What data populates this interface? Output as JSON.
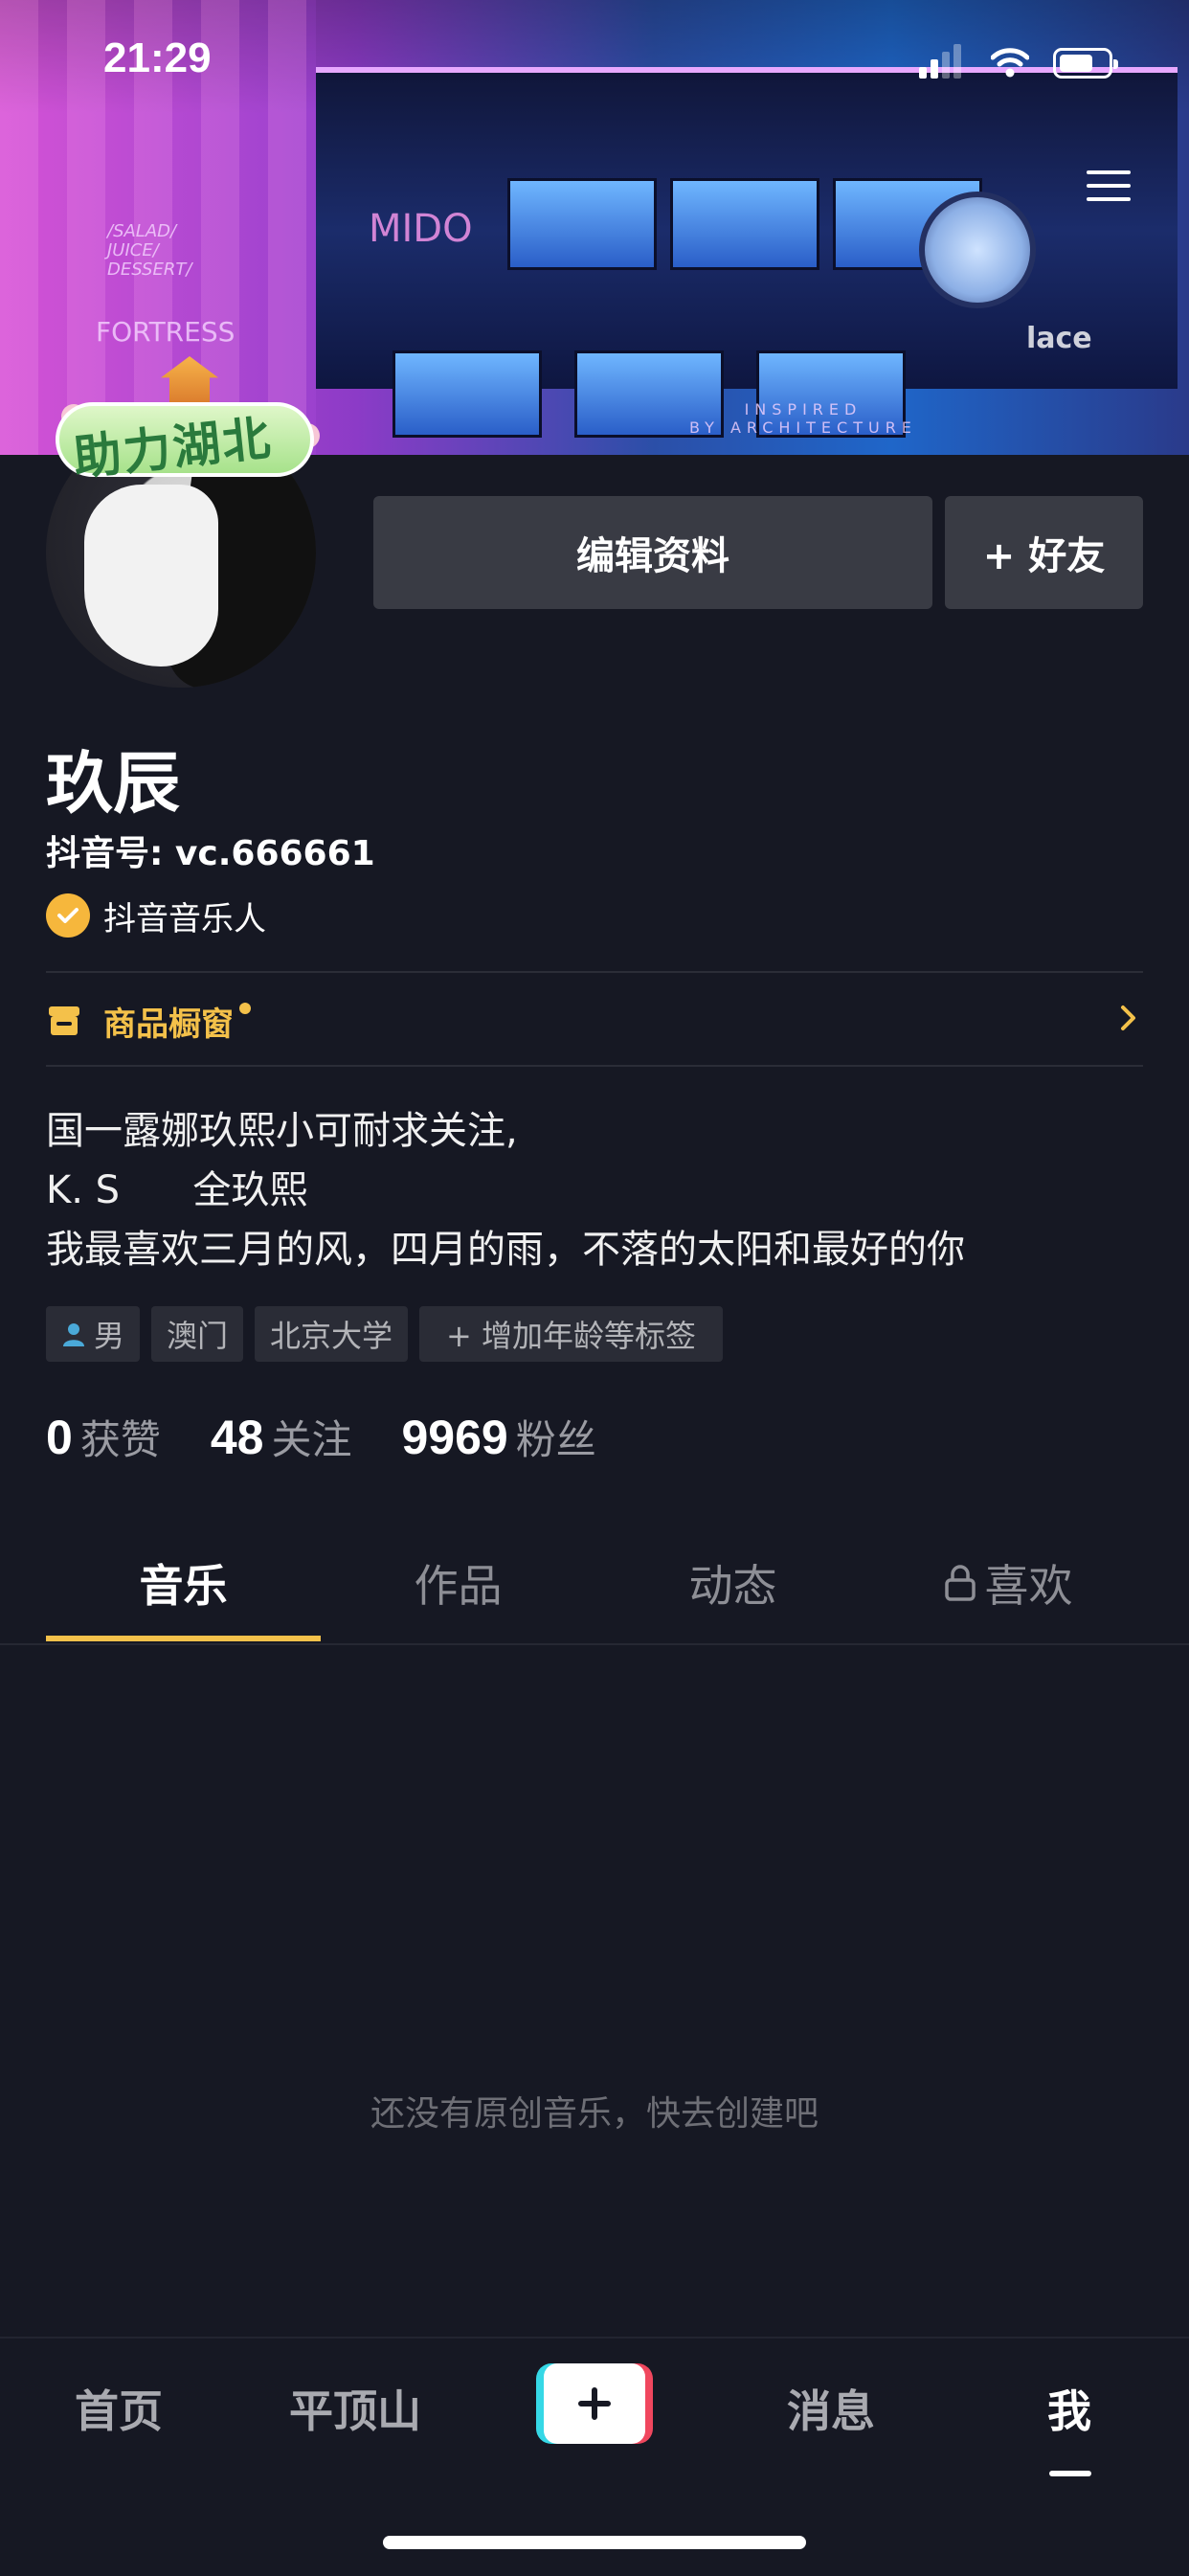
{
  "status_bar": {
    "time": "21:29"
  },
  "cover": {
    "texts": [
      "/SALAD/",
      "JUICE/",
      "DESSERT/",
      "FORTRESS",
      "MIDO",
      "lace",
      "INSPIRED",
      "BY ARCHITECTURE"
    ]
  },
  "avatar_badge": {
    "text": "助力湖北"
  },
  "actions": {
    "edit_profile": "编辑资料",
    "add_friend": "+ 好友"
  },
  "profile": {
    "name": "玖辰",
    "douyin_id": "抖音号: vc.666661",
    "verified_label": "抖音音乐人"
  },
  "shop": {
    "label": "商品橱窗"
  },
  "bio": {
    "line1": "国一露娜玖熙小可耐求关注,",
    "line2": "K. S      全玖熙",
    "line3": "我最喜欢三月的风，四月的雨，不落的太阳和最好的你"
  },
  "tags": {
    "gender": "男",
    "location": "澳门",
    "school": "北京大学",
    "add": "+ 增加年龄等标签"
  },
  "stats": {
    "likes_num": "0",
    "likes_label": "获赞",
    "following_num": "48",
    "following_label": "关注",
    "followers_num": "9969",
    "followers_label": "粉丝"
  },
  "tabs": {
    "music": "音乐",
    "works": "作品",
    "dynamics": "动态",
    "likes": "喜欢"
  },
  "empty_state": "还没有原创音乐，快去创建吧",
  "bottom_nav": {
    "home": "首页",
    "city": "平顶山",
    "messages": "消息",
    "me": "我"
  },
  "colors": {
    "background": "#161823",
    "accent": "#f4c14a",
    "button": "#393b44"
  }
}
